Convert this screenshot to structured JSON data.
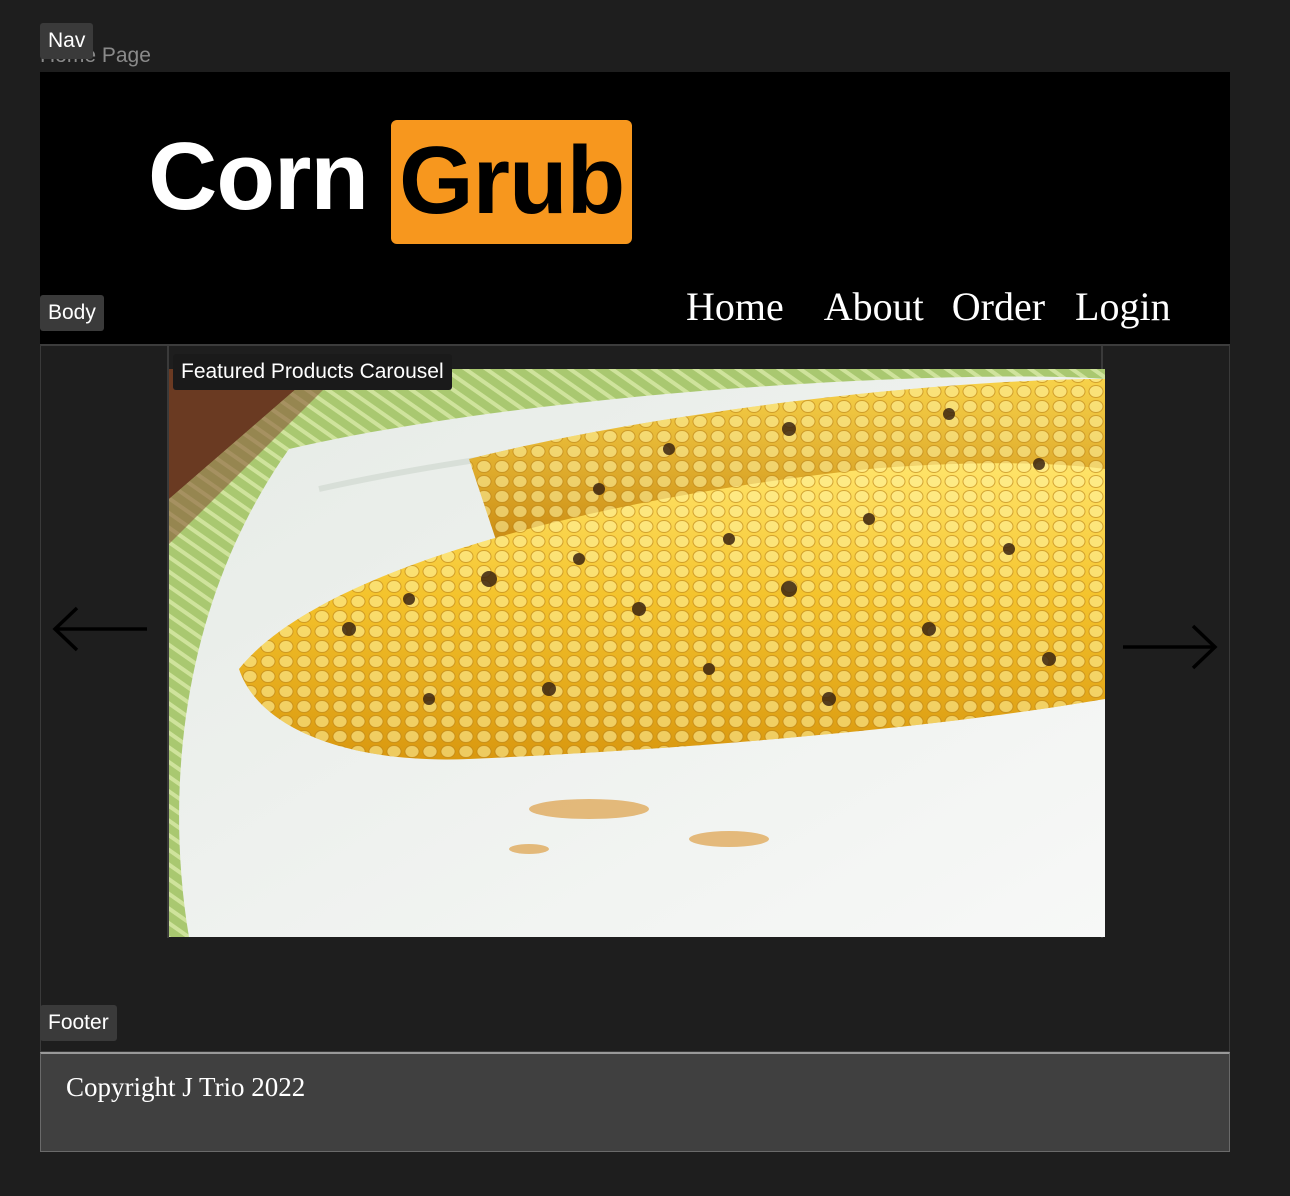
{
  "frame": {
    "title": "Home Page"
  },
  "tags": {
    "nav": "Nav",
    "body": "Body",
    "carousel": "Featured Products Carousel",
    "footer": "Footer"
  },
  "logo": {
    "part1": "Corn",
    "part2": "Grub",
    "accent_color": "#f7971e"
  },
  "menu": {
    "items": [
      {
        "label": "Home"
      },
      {
        "label": "About"
      },
      {
        "label": "Order"
      },
      {
        "label": "Login"
      }
    ]
  },
  "carousel": {
    "image_subject": "grilled-corn-on-plate",
    "prev_icon": "arrow-left-icon",
    "next_icon": "arrow-right-icon"
  },
  "footer": {
    "copyright": "Copyright J Trio 2022"
  },
  "colors": {
    "page_bg": "#1e1e1e",
    "nav_bg": "#000000",
    "footer_bg": "#404040"
  }
}
